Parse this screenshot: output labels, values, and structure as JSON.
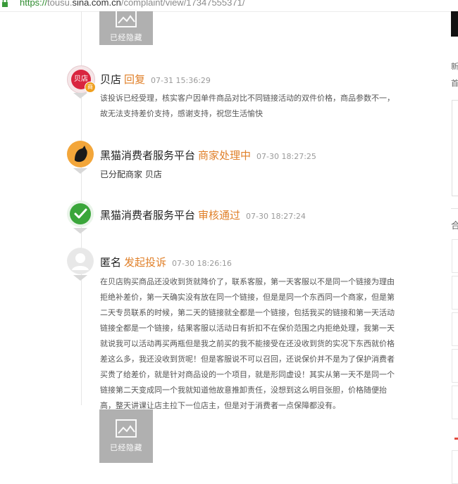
{
  "url_bar": {
    "protocol": "https://",
    "host_prefix": "tousu.",
    "host_domain": "sina.com.cn",
    "path": "/complaint/view/17347555371/"
  },
  "hidden_image_label": "已经隐藏",
  "entries": [
    {
      "name": "贝店",
      "action": "回复",
      "time": "07-31 15:36:29",
      "avatar_text": "贝店",
      "badge_text": "商",
      "body": "该投诉已经受理，核实客户因单件商品对比不同链接活动的双件价格，商品参数不一，故无法支持差价支持，感谢支持，祝您生活愉快"
    },
    {
      "name": "黑猫消费者服务平台",
      "action": "商家处理中",
      "time": "07-30 18:27:25",
      "body": "已分配商家 贝店"
    },
    {
      "name": "黑猫消费者服务平台",
      "action": "审核通过",
      "time": "07-30 18:27:24"
    },
    {
      "name": "匿名",
      "action": "发起投诉",
      "time": "07-30 18:26:16",
      "body": "在贝店购买商品还没收到货就降价了，联系客服，第一天客服以不是同一个链接为理由拒绝补差价，第一天确实没有放在同一个链接，但是是同一个东西同一个商家，但是第二天专员联系的时候，第二天的链接就全都是一个链接，包括我买的链接和第一天活动链接全都是一个链接，结果客服以活动日有折扣不在保价范围之内拒绝处理，我第一天就说我可以活动再买两瓶但是我之前买的我不能接受在还没收到货的实况下东西就价格差这么多，我还没收到货呢！但是客服说不可以召回，还说保价并不是为了保护消费者买贵了给差价，就是针对商品设的一个项目，就是形同虚设！其实从第一天不是同一个链接第二天变成同一个我就知道他故意推卸责任，没想到这么明目张胆，价格随便抬高，整天讲课让店主拉下一位店主，但是对于消费者一点保障都没有。"
    }
  ],
  "right_panel": {
    "text_1": "新",
    "text_2": "首",
    "text_3": "合"
  },
  "colors": {
    "action_orange": "#e0802a",
    "badge_orange": "#f0a020",
    "beidian_red": "#d9253f",
    "check_green": "#3aa63a"
  }
}
